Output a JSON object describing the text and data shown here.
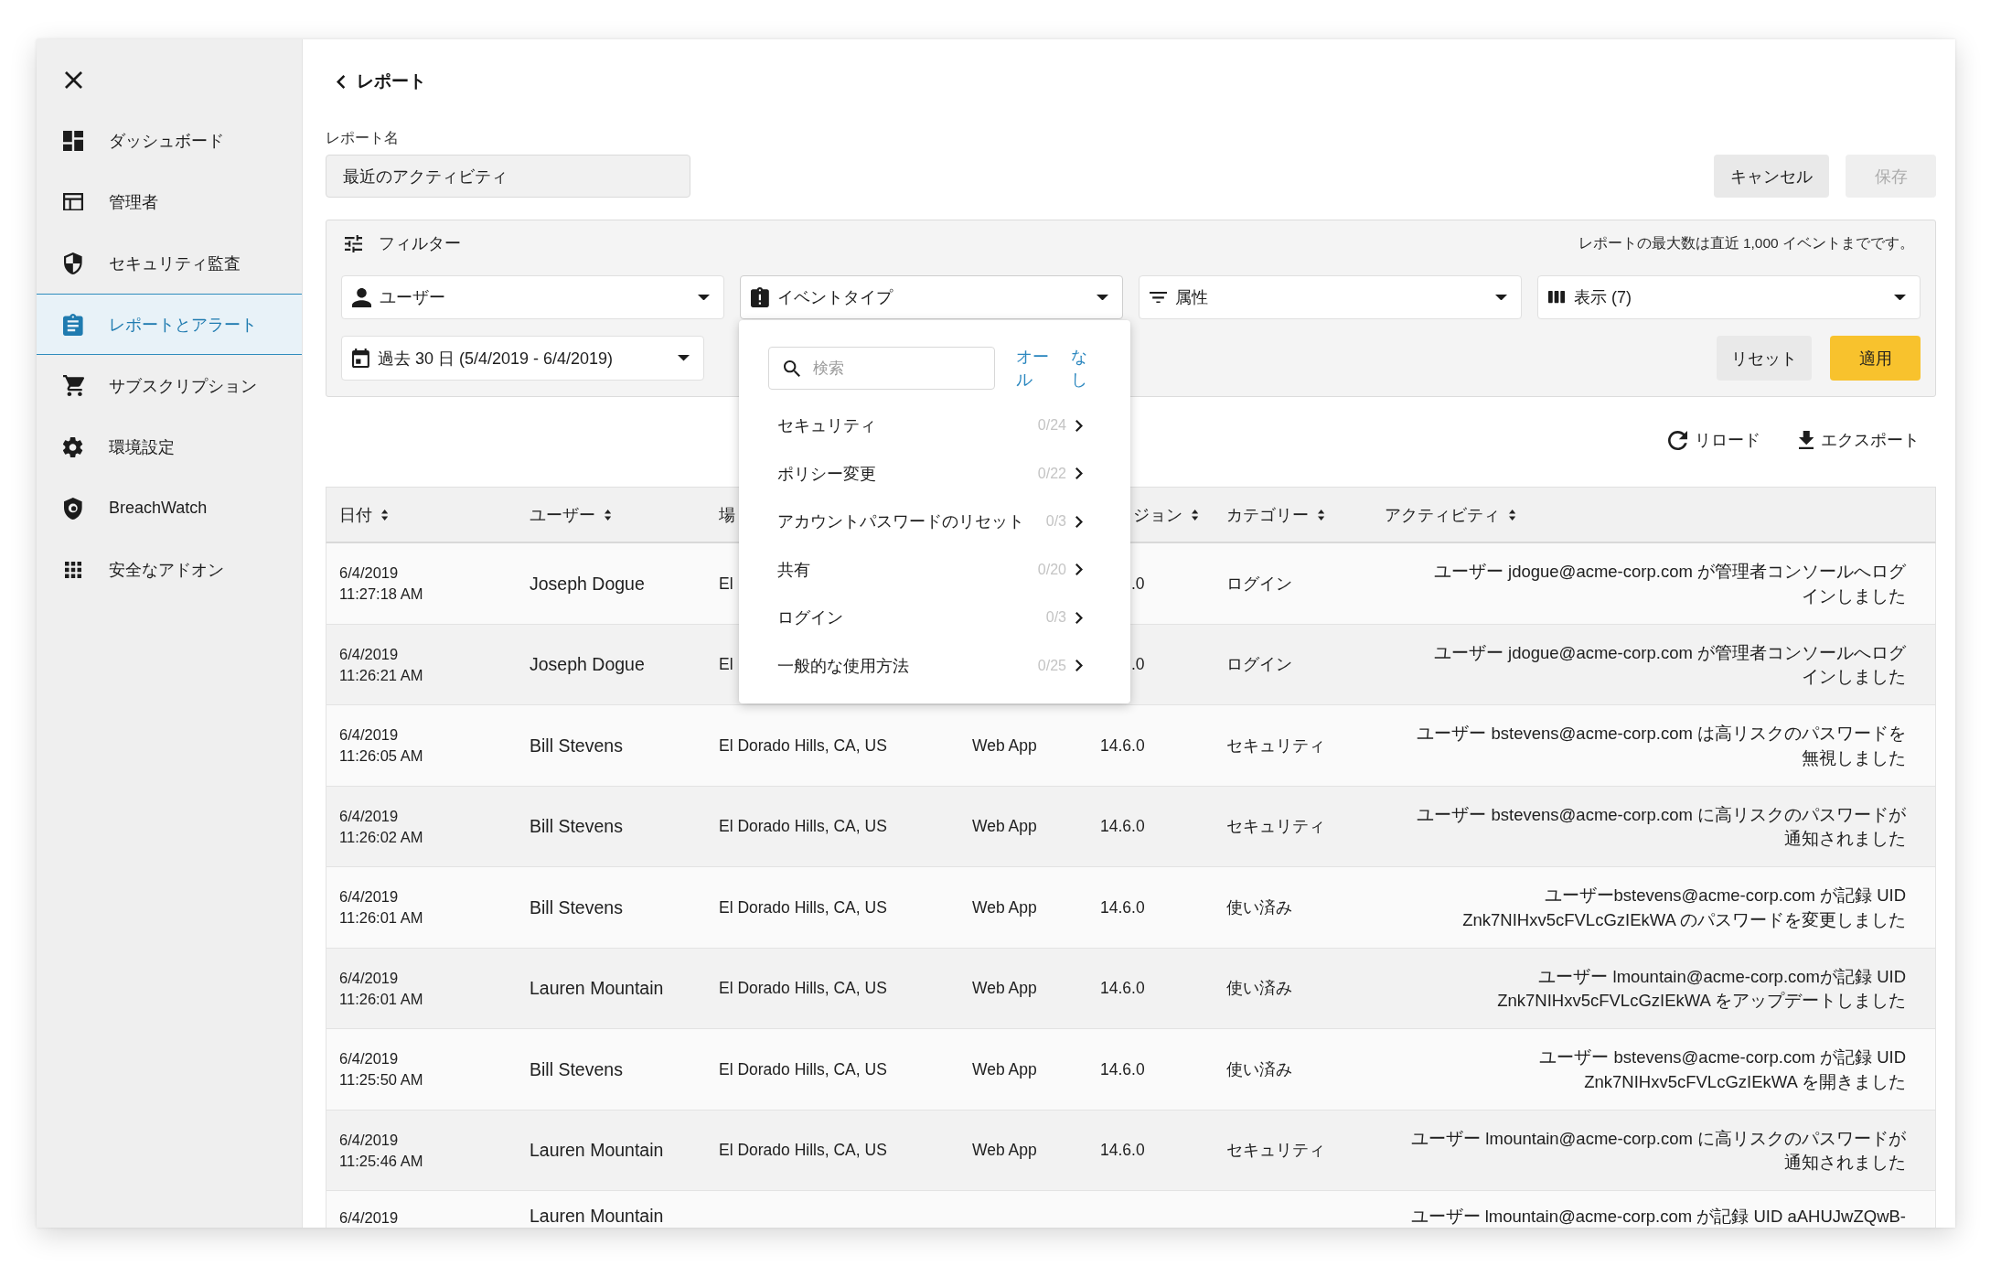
{
  "sidebar": {
    "items": [
      {
        "label": "ダッシュボード",
        "selected": false
      },
      {
        "label": "管理者",
        "selected": false
      },
      {
        "label": "セキュリティ監査",
        "selected": false
      },
      {
        "label": "レポートとアラート",
        "selected": true
      },
      {
        "label": "サブスクリプション",
        "selected": false
      },
      {
        "label": "環境設定",
        "selected": false
      },
      {
        "label": "BreachWatch",
        "selected": false
      },
      {
        "label": "安全なアドオン",
        "selected": false
      }
    ]
  },
  "page_header": {
    "back_link": "レポート"
  },
  "report_name": {
    "label": "レポート名",
    "value": "最近のアクティビティ"
  },
  "actions": [
    {
      "label": "キャンセル",
      "disabled": false
    },
    {
      "label": "保存",
      "disabled": true
    }
  ],
  "filters": {
    "title": "フィルター",
    "note": "レポートの最大数は直近 1,000 イベントまでです。",
    "dropdowns": [
      {
        "label": "ユーザー",
        "open": false
      },
      {
        "label": "イベントタイプ",
        "open": true,
        "menu": {
          "search": {
            "placeholder": "検索"
          },
          "select_all": "オール",
          "select_none": "なし",
          "items": [
            {
              "label": "セキュリティ",
              "count": "0/24"
            },
            {
              "label": "ポリシー変更",
              "count": "0/22"
            },
            {
              "label": "アカウントパスワードのリセット",
              "count": "0/3"
            },
            {
              "label": "共有",
              "count": "0/20"
            },
            {
              "label": "ログイン",
              "count": "0/3"
            },
            {
              "label": "一般的な使用方法",
              "count": "0/25"
            }
          ]
        }
      },
      {
        "label": "属性",
        "open": false
      },
      {
        "label": "表示 (7)",
        "open": false
      }
    ],
    "date_range": "過去 30 日 (5/4/2019 - 6/4/2019)",
    "buttons": [
      {
        "label": "リセット",
        "kind": "plain"
      },
      {
        "label": "適用",
        "kind": "primary"
      }
    ]
  },
  "toolbar": [
    {
      "label": "リロード"
    },
    {
      "label": "エクスポート"
    }
  ],
  "table": {
    "columns": [
      {
        "label": "日付",
        "sortable": true
      },
      {
        "label": "ユーザー",
        "sortable": true
      },
      {
        "label": "場",
        "sortable": false
      },
      {
        "label": "ジョン",
        "sortable": true
      },
      {
        "label": "カテゴリー",
        "sortable": true
      },
      {
        "label": "アクティビティ",
        "sortable": true
      }
    ],
    "rows": [
      {
        "date": "6/4/2019",
        "time": "11:27:18 AM",
        "user": "Joseph Dogue",
        "location": "El",
        "version": ".0",
        "category": "ログイン",
        "activity": [
          "ユーザー jdogue@acme-corp.com が管理者コンソールへログ",
          "インしました"
        ]
      },
      {
        "date": "6/4/2019",
        "time": "11:26:21 AM",
        "user": "Joseph Dogue",
        "location": "El",
        "version": ".0",
        "category": "ログイン",
        "activity": [
          "ユーザー jdogue@acme-corp.com が管理者コンソールへログ",
          "インしました"
        ]
      },
      {
        "date": "6/4/2019",
        "time": "11:26:05 AM",
        "user": "Bill Stevens",
        "location": "El Dorado Hills, CA, US",
        "device": "Web App",
        "version": "14.6.0",
        "category": "セキュリティ",
        "activity": [
          "ユーザー bstevens@acme-corp.com は高リスクのパスワードを",
          "無視しました"
        ]
      },
      {
        "date": "6/4/2019",
        "time": "11:26:02 AM",
        "user": "Bill Stevens",
        "location": "El Dorado Hills, CA, US",
        "device": "Web App",
        "version": "14.6.0",
        "category": "セキュリティ",
        "activity": [
          "ユーザー bstevens@acme-corp.com に高リスクのパスワードが",
          "通知されました"
        ]
      },
      {
        "date": "6/4/2019",
        "time": "11:26:01 AM",
        "user": "Bill Stevens",
        "location": "El Dorado Hills, CA, US",
        "device": "Web App",
        "version": "14.6.0",
        "category": "使い済み",
        "activity": [
          "ユーザーbstevens@acme-corp.com が記録 UID",
          "Znk7NIHxv5cFVLcGzIEkWA のパスワードを変更しました"
        ]
      },
      {
        "date": "6/4/2019",
        "time": "11:26:01 AM",
        "user": "Lauren Mountain",
        "location": "El Dorado Hills, CA, US",
        "device": "Web App",
        "version": "14.6.0",
        "category": "使い済み",
        "activity": [
          "ユーザー lmountain@acme-corp.comが記録 UID",
          "Znk7NIHxv5cFVLcGzIEkWA をアップデートしました"
        ]
      },
      {
        "date": "6/4/2019",
        "time": "11:25:50 AM",
        "user": "Bill Stevens",
        "location": "El Dorado Hills, CA, US",
        "device": "Web App",
        "version": "14.6.0",
        "category": "使い済み",
        "activity": [
          "ユーザー bstevens@acme-corp.com が記録 UID",
          "Znk7NIHxv5cFVLcGzIEkWA を開きました"
        ]
      },
      {
        "date": "6/4/2019",
        "time": "11:25:46 AM",
        "user": "Lauren Mountain",
        "location": "El Dorado Hills, CA, US",
        "device": "Web App",
        "version": "14.6.0",
        "category": "セキュリティ",
        "activity": [
          "ユーザー lmountain@acme-corp.com に高リスクのパスワードが",
          "通知されました"
        ]
      },
      {
        "date": "6/4/2019",
        "user": "Lauren Mountain",
        "activity": [
          "ユーザー lmountain@acme-corp.com が記録 UID aAHUJwZQwB-"
        ]
      }
    ]
  }
}
